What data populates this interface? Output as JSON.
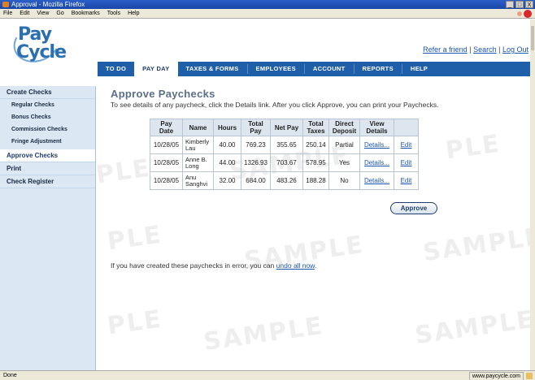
{
  "window": {
    "title": "Approval - Mozilla Firefox",
    "controls": [
      "_",
      "□",
      "X"
    ]
  },
  "menu": [
    "File",
    "Edit",
    "View",
    "Go",
    "Bookmarks",
    "Tools",
    "Help"
  ],
  "logo": {
    "text_top": "Pay",
    "text_bottom": "Cycle"
  },
  "top_links": {
    "refer": "Refer a friend",
    "sep1": "|",
    "search": "Search",
    "sep2": "|",
    "logout": "Log Out"
  },
  "nav_tabs": [
    "TO DO",
    "PAY DAY",
    "TAXES & FORMS",
    "EMPLOYEES",
    "ACCOUNT",
    "REPORTS",
    "HELP"
  ],
  "sidebar": {
    "create_checks": "Create Checks",
    "regular": "Regular Checks",
    "bonus": "Bonus Checks",
    "commission": "Commission Checks",
    "fringe": "Fringe Adjustment",
    "approve": "Approve Checks",
    "print": "Print",
    "register": "Check Register"
  },
  "page": {
    "title": "Approve Paychecks",
    "description": "To see details of any paycheck, click the Details link. After you click Approve, you can print your Paychecks.",
    "approve_button": "Approve",
    "error_text": "If you have created these paychecks in error, you can",
    "undo_link": "undo all now",
    "error_end": "."
  },
  "table": {
    "headers": [
      "Pay Date",
      "Name",
      "Hours",
      "Total Pay",
      "Net Pay",
      "Total Taxes",
      "Direct Deposit",
      "View Details",
      ""
    ],
    "rows": [
      {
        "date": "10/28/05",
        "name": "Kimberly Lau",
        "hours": "40.00",
        "total_pay": "769.23",
        "net_pay": "355.65",
        "taxes": "250.14",
        "deposit": "Partial",
        "details": "Details...",
        "edit": "Edit"
      },
      {
        "date": "10/28/05",
        "name": "Anne B. Long",
        "hours": "44.00",
        "total_pay": "1326.93",
        "net_pay": "703.67",
        "taxes": "578.95",
        "deposit": "Yes",
        "details": "Details...",
        "edit": "Edit"
      },
      {
        "date": "10/28/05",
        "name": "Anu Sanghvi",
        "hours": "32.00",
        "total_pay": "684.00",
        "net_pay": "483.26",
        "taxes": "188.28",
        "deposit": "No",
        "details": "Details...",
        "edit": "Edit"
      }
    ]
  },
  "watermark": "SAMPLE",
  "watermark_partial": "PLE",
  "status": {
    "left": "Done",
    "url": "www.paycycle.com"
  }
}
